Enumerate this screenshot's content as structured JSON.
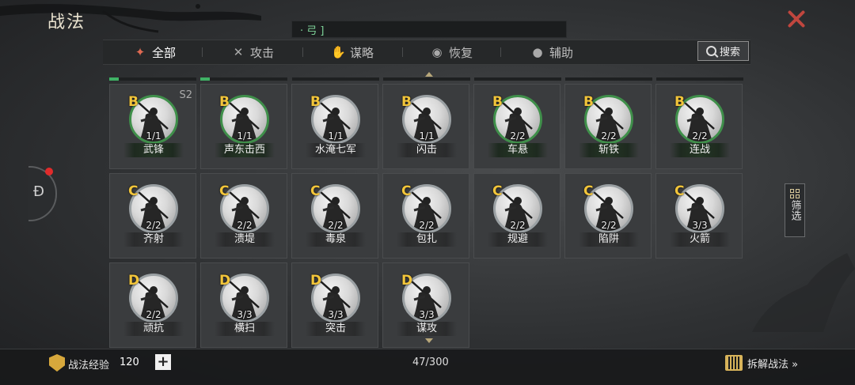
{
  "header": {
    "title": "战法"
  },
  "top_strip": {
    "text": "· 弓 ]"
  },
  "tabs": [
    {
      "label": "全部",
      "icon": "scroll-icon",
      "active": true
    },
    {
      "label": "攻击",
      "icon": "crossed-swords-icon",
      "active": false
    },
    {
      "label": "谋略",
      "icon": "hand-icon",
      "active": false
    },
    {
      "label": "恢复",
      "icon": "pot-icon",
      "active": false
    },
    {
      "label": "辅助",
      "icon": "bag-icon",
      "active": false
    }
  ],
  "search": {
    "label": "搜索"
  },
  "filter": {
    "label": "筛选"
  },
  "colors": {
    "accent_red": "#c0463e",
    "grade_gold": "#f2c53a",
    "equipped_green": "#3f8f4a"
  },
  "tactics": [
    {
      "grade": "B",
      "name": "武锋",
      "level": "1/1",
      "season": "S2",
      "equipped": true
    },
    {
      "grade": "B",
      "name": "声东击西",
      "level": "1/1",
      "equipped": true
    },
    {
      "grade": "B",
      "name": "水淹七军",
      "level": "1/1",
      "equipped": false
    },
    {
      "grade": "B",
      "name": "闪击",
      "level": "1/1",
      "equipped": false
    },
    {
      "grade": "B",
      "name": "车悬",
      "level": "2/2",
      "equipped": true
    },
    {
      "grade": "B",
      "name": "斩铁",
      "level": "2/2",
      "equipped": true
    },
    {
      "grade": "B",
      "name": "连战",
      "level": "2/2",
      "equipped": true
    },
    {
      "grade": "C",
      "name": "齐射",
      "level": "2/2",
      "equipped": false
    },
    {
      "grade": "C",
      "name": "溃堤",
      "level": "2/2",
      "equipped": false
    },
    {
      "grade": "C",
      "name": "毒泉",
      "level": "2/2",
      "equipped": false
    },
    {
      "grade": "C",
      "name": "包扎",
      "level": "2/2",
      "equipped": false
    },
    {
      "grade": "C",
      "name": "规避",
      "level": "2/2",
      "equipped": false
    },
    {
      "grade": "C",
      "name": "陷阱",
      "level": "2/2",
      "equipped": false
    },
    {
      "grade": "C",
      "name": "火箭",
      "level": "3/3",
      "equipped": false
    },
    {
      "grade": "D",
      "name": "顽抗",
      "level": "2/2",
      "equipped": false
    },
    {
      "grade": "D",
      "name": "横扫",
      "level": "3/3",
      "equipped": false
    },
    {
      "grade": "D",
      "name": "突击",
      "level": "3/3",
      "equipped": false
    },
    {
      "grade": "D",
      "name": "谋攻",
      "level": "3/3",
      "equipped": false
    }
  ],
  "footer": {
    "exp_label": "战法经验",
    "exp_value": "120",
    "add_label": "+",
    "count": "47/300",
    "decompose_label": "拆解战法 »"
  }
}
